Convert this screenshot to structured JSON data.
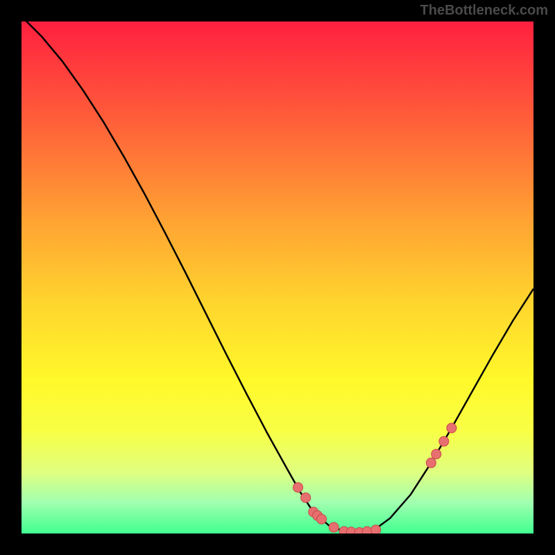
{
  "watermark": "TheBottleneck.com",
  "chart_data": {
    "type": "line",
    "title": "",
    "xlabel": "",
    "ylabel": "",
    "xlim": [
      0,
      100
    ],
    "ylim": [
      0,
      100
    ],
    "series": [
      {
        "name": "curve",
        "x": [
          0,
          4,
          8,
          12,
          16,
          20,
          24,
          28,
          32,
          36,
          40,
          44,
          48,
          52,
          54.5,
          57,
          60,
          63,
          66,
          69,
          72,
          76,
          80,
          84,
          88,
          92,
          96,
          100
        ],
        "values": [
          101,
          97,
          92.2,
          86.6,
          80.4,
          73.6,
          66.4,
          58.8,
          51,
          43,
          35,
          27.2,
          19.6,
          12.4,
          8,
          4.2,
          1.6,
          0.4,
          0.2,
          0.8,
          3,
          7.6,
          13.8,
          20.6,
          27.7,
          34.8,
          41.6,
          47.8
        ]
      }
    ],
    "markers": {
      "name": "points",
      "x": [
        54,
        55.5,
        57,
        57.8,
        58.6,
        61,
        63,
        64.4,
        66,
        67.5,
        69.2,
        80,
        81,
        82.5,
        84
      ],
      "values": [
        9,
        7,
        4.2,
        3.5,
        2.8,
        1.2,
        0.4,
        0.3,
        0.2,
        0.4,
        0.7,
        13.8,
        15.5,
        18,
        20.6
      ]
    }
  }
}
